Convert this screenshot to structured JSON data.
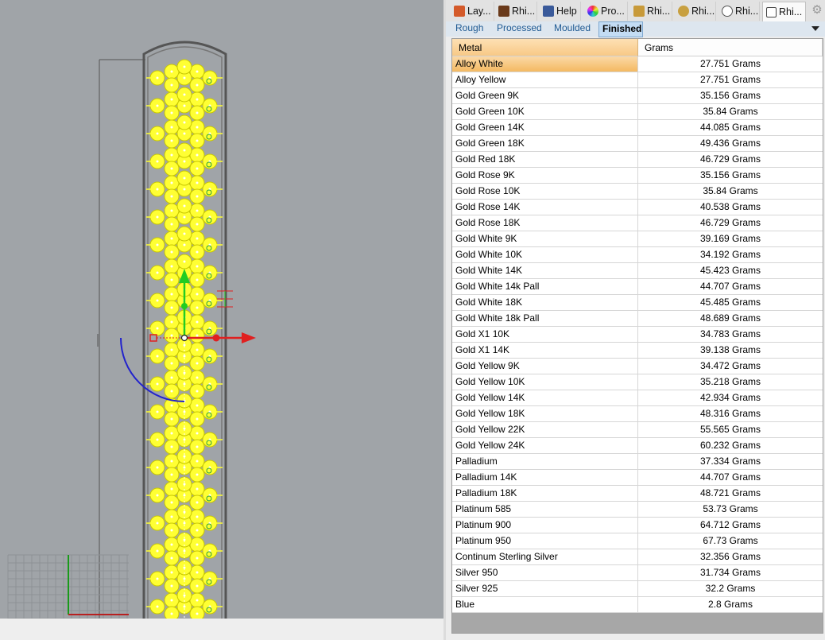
{
  "viewport": {
    "name": "3D model viewport"
  },
  "panel_tabs": [
    {
      "label": "Lay...",
      "icon": "layers-icon",
      "color": "#d45a2a"
    },
    {
      "label": "Rhi...",
      "icon": "rg-icon",
      "color": "#6a3a1a"
    },
    {
      "label": "Help",
      "icon": "help-icon",
      "color": "#3a5a9a"
    },
    {
      "label": "Pro...",
      "icon": "color-wheel-icon",
      "color": "#cc3366"
    },
    {
      "label": "Rhi...",
      "icon": "plugin-icon",
      "color": "#c89a3a"
    },
    {
      "label": "Rhi...",
      "icon": "plugin-icon",
      "color": "#c8a040"
    },
    {
      "label": "Rhi...",
      "icon": "plugin-icon",
      "color": "#555555"
    },
    {
      "label": "Rhi...",
      "icon": "plugin-icon",
      "color": "#444444"
    }
  ],
  "sub_tabs": [
    "Rough",
    "Processed",
    "Moulded",
    "Finished"
  ],
  "active_sub_tab": "Finished",
  "grid": {
    "headers": {
      "metal": "Metal",
      "grams": "Grams"
    },
    "selected_row": "Alloy White",
    "rows": [
      {
        "metal": "Alloy White",
        "grams": "27.751 Grams"
      },
      {
        "metal": "Alloy Yellow",
        "grams": "27.751 Grams"
      },
      {
        "metal": "Gold Green 9K",
        "grams": "35.156 Grams"
      },
      {
        "metal": "Gold Green 10K",
        "grams": "35.84 Grams"
      },
      {
        "metal": "Gold Green 14K",
        "grams": "44.085 Grams"
      },
      {
        "metal": "Gold Green 18K",
        "grams": "49.436 Grams"
      },
      {
        "metal": "Gold Red 18K",
        "grams": "46.729 Grams"
      },
      {
        "metal": "Gold Rose 9K",
        "grams": "35.156 Grams"
      },
      {
        "metal": "Gold Rose 10K",
        "grams": "35.84 Grams"
      },
      {
        "metal": "Gold Rose 14K",
        "grams": "40.538 Grams"
      },
      {
        "metal": "Gold Rose 18K",
        "grams": "46.729 Grams"
      },
      {
        "metal": "Gold White 9K",
        "grams": "39.169 Grams"
      },
      {
        "metal": "Gold White 10K",
        "grams": "34.192 Grams"
      },
      {
        "metal": "Gold White 14K",
        "grams": "45.423 Grams"
      },
      {
        "metal": "Gold White 14k Pall",
        "grams": "44.707 Grams"
      },
      {
        "metal": "Gold White 18K",
        "grams": "45.485 Grams"
      },
      {
        "metal": "Gold White 18k Pall",
        "grams": "48.689 Grams"
      },
      {
        "metal": "Gold X1 10K",
        "grams": "34.783 Grams"
      },
      {
        "metal": "Gold X1 14K",
        "grams": "39.138 Grams"
      },
      {
        "metal": "Gold Yellow 9K",
        "grams": "34.472 Grams"
      },
      {
        "metal": "Gold Yellow 10K",
        "grams": "35.218 Grams"
      },
      {
        "metal": "Gold Yellow 14K",
        "grams": "42.934 Grams"
      },
      {
        "metal": "Gold Yellow 18K",
        "grams": "48.316 Grams"
      },
      {
        "metal": "Gold Yellow 22K",
        "grams": "55.565 Grams"
      },
      {
        "metal": "Gold Yellow 24K",
        "grams": "60.232 Grams"
      },
      {
        "metal": "Palladium",
        "grams": "37.334 Grams"
      },
      {
        "metal": "Palladium 14K",
        "grams": "44.707 Grams"
      },
      {
        "metal": "Palladium 18K",
        "grams": "48.721 Grams"
      },
      {
        "metal": "Platinum 585",
        "grams": "53.73 Grams"
      },
      {
        "metal": "Platinum 900",
        "grams": "64.712 Grams"
      },
      {
        "metal": "Platinum 950",
        "grams": "67.73 Grams"
      },
      {
        "metal": "Continum Sterling Silver",
        "grams": "32.356 Grams"
      },
      {
        "metal": "Silver 950",
        "grams": "31.734 Grams"
      },
      {
        "metal": "Silver 925",
        "grams": "32.2 Grams"
      },
      {
        "metal": "Blue",
        "grams": "2.8 Grams"
      }
    ]
  },
  "colors": {
    "viewport_bg": "#a0a4a8",
    "model_fill": "#ffff33",
    "gumball_x": "#e02020",
    "gumball_y": "#22cc22",
    "rotation_arc": "#2222cc",
    "selected_row": "#f4b962",
    "active_subtab": "#c3dcf4"
  }
}
